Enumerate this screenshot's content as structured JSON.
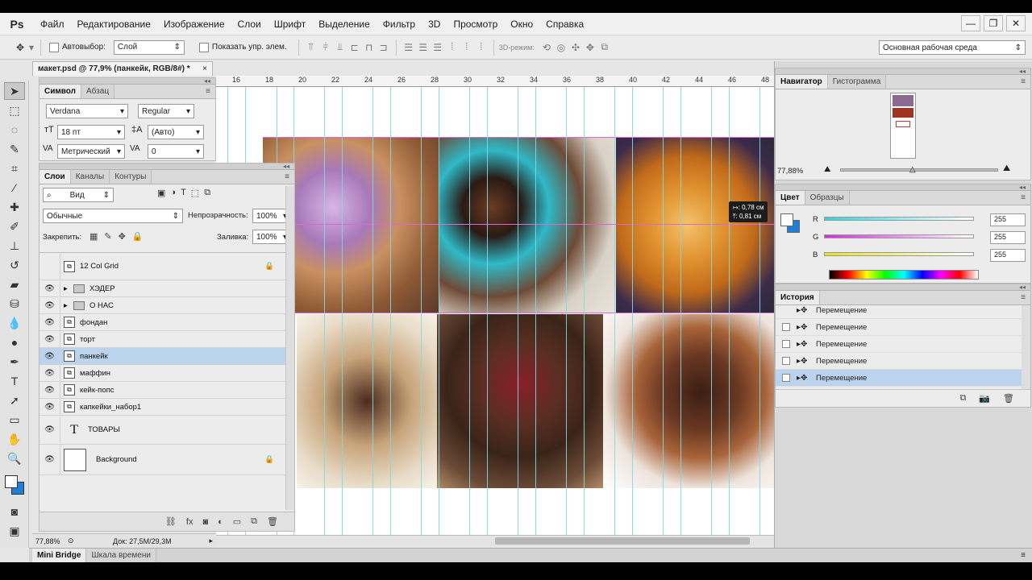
{
  "app": {
    "logo": "Ps"
  },
  "menu": [
    "Файл",
    "Редактирование",
    "Изображение",
    "Слои",
    "Шрифт",
    "Выделение",
    "Фильтр",
    "3D",
    "Просмотр",
    "Окно",
    "Справка"
  ],
  "options": {
    "autoselect_label": "Автовыбор:",
    "autoselect_value": "Слой",
    "show_controls_label": "Показать упр. элем.",
    "mode3d_label": "3D-режим:",
    "workspace": "Основная рабочая среда"
  },
  "document": {
    "tab_title": "макет.psd @ 77,9% (панкейк, RGB/8#) *",
    "zoom": "77,88%",
    "doc_size": "Док: 27,5M/29,3M",
    "ruler_ticks": [
      "16",
      "18",
      "20",
      "22",
      "24",
      "26",
      "28",
      "30",
      "32",
      "34",
      "36",
      "38",
      "40",
      "42",
      "44",
      "46",
      "48"
    ],
    "tooltip_x": "↦: 0,78 см",
    "tooltip_y": "⤒: 0,81 см"
  },
  "character_panel": {
    "tabs": [
      "Символ",
      "Абзац"
    ],
    "font_family": "Verdana",
    "font_style": "Regular",
    "font_size": "18 пт",
    "leading": "(Авто)",
    "kerning": "Метрический",
    "tracking": "0"
  },
  "layers_panel": {
    "tabs": [
      "Слои",
      "Каналы",
      "Контуры"
    ],
    "filter": "Вид",
    "blend_mode": "Обычные",
    "opacity_label": "Непрозрачность:",
    "opacity": "100%",
    "lock_label": "Закрепить:",
    "fill_label": "Заливка:",
    "fill": "100%",
    "layers": [
      {
        "name": "12 Col Grid",
        "type": "smart",
        "visible": false,
        "locked": true
      },
      {
        "name": "ХЭДЕР",
        "type": "group",
        "visible": true
      },
      {
        "name": "О НАС",
        "type": "group",
        "visible": true
      },
      {
        "name": "фондан",
        "type": "smart",
        "visible": true
      },
      {
        "name": "торт",
        "type": "smart",
        "visible": true
      },
      {
        "name": "панкейк",
        "type": "smart",
        "visible": true,
        "selected": true
      },
      {
        "name": "маффин",
        "type": "smart",
        "visible": true
      },
      {
        "name": "кейк-попс",
        "type": "smart",
        "visible": true
      },
      {
        "name": "капкейки_набор1",
        "type": "smart",
        "visible": true
      },
      {
        "name": "ТОВАРЫ",
        "type": "text",
        "visible": true
      },
      {
        "name": "Background",
        "type": "background",
        "visible": true,
        "locked": true
      }
    ]
  },
  "navigator_panel": {
    "tabs": [
      "Навигатор",
      "Гистограмма"
    ],
    "zoom": "77,88%"
  },
  "color_panel": {
    "tabs": [
      "Цвет",
      "Образцы"
    ],
    "channels": [
      {
        "label": "R",
        "value": "255"
      },
      {
        "label": "G",
        "value": "255"
      },
      {
        "label": "B",
        "value": "255"
      }
    ],
    "colors": {
      "R": "#2fd4e0",
      "G": "#d62be0",
      "B": "#e8e21d",
      "foreground": "#ffffff",
      "background": "#1e7fd8"
    }
  },
  "history_panel": {
    "tab": "История",
    "items": [
      "Перемещение",
      "Перемещение",
      "Перемещение",
      "Перемещение",
      "Перемещение"
    ]
  },
  "bottom_tabs": [
    "Mini Bridge",
    "Шкала времени"
  ]
}
